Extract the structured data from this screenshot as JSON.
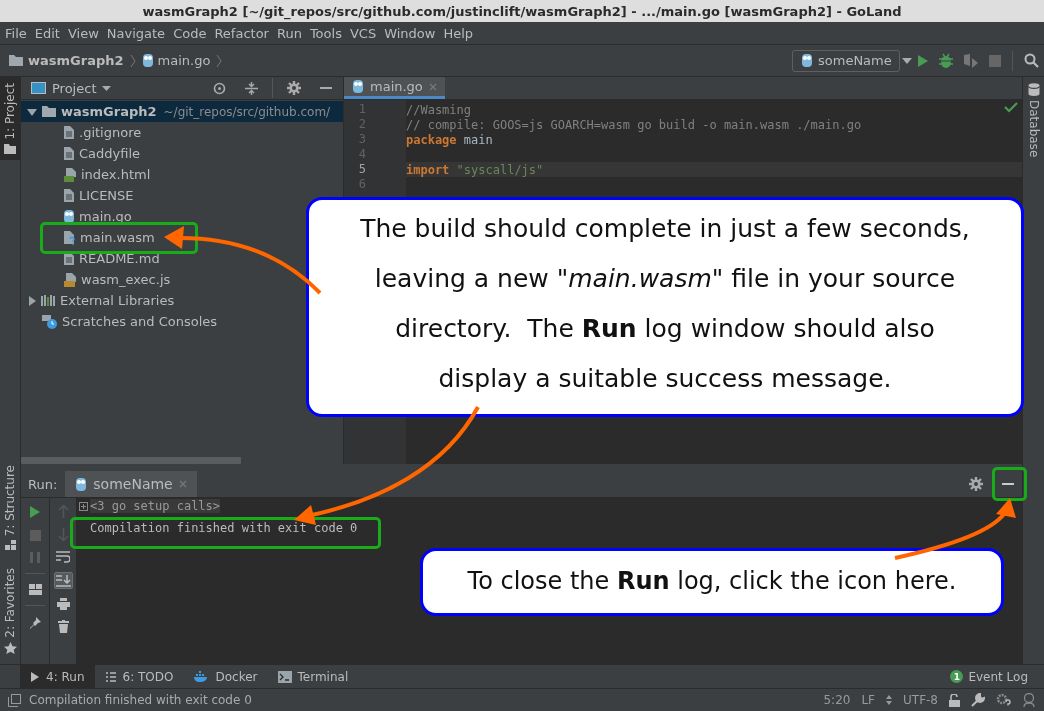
{
  "window": {
    "title": "wasmGraph2 [~/git_repos/src/github.com/justinclift/wasmGraph2] - .../main.go [wasmGraph2] - GoLand"
  },
  "menu": [
    "File",
    "Edit",
    "View",
    "Navigate",
    "Code",
    "Refactor",
    "Run",
    "Tools",
    "VCS",
    "Window",
    "Help"
  ],
  "breadcrumb": [
    {
      "label": "wasmGraph2",
      "kind": "folder"
    },
    {
      "label": "main.go",
      "kind": "go"
    }
  ],
  "run_config": {
    "label": "someName"
  },
  "left_stripe_top": [
    {
      "label": "1: Project",
      "selected": true
    }
  ],
  "left_stripe_bottom": [
    {
      "label": "7: Structure",
      "selected": false
    },
    {
      "label": "2: Favorites",
      "selected": false
    }
  ],
  "right_stripe": [
    {
      "label": "Database",
      "selected": false
    }
  ],
  "project_panel": {
    "title": "Project",
    "tree": [
      {
        "label": "wasmGraph2",
        "path": "~/git_repos/src/github.com/",
        "kind": "folder",
        "expanded": true,
        "selected": true,
        "children": [
          {
            "label": ".gitignore",
            "kind": "text",
            "selected": false
          },
          {
            "label": "Caddyfile",
            "kind": "text",
            "selected": false
          },
          {
            "label": "index.html",
            "kind": "html",
            "selected": false
          },
          {
            "label": "LICENSE",
            "kind": "text",
            "selected": false
          },
          {
            "label": "main.go",
            "kind": "go",
            "selected": false
          },
          {
            "label": "main.wasm",
            "kind": "unknown",
            "selected": false
          },
          {
            "label": "README.md",
            "kind": "text",
            "selected": false
          },
          {
            "label": "wasm_exec.js",
            "kind": "js",
            "selected": false
          }
        ]
      },
      {
        "label": "External Libraries",
        "kind": "libraries",
        "expanded": false,
        "selected": false
      },
      {
        "label": "Scratches and Consoles",
        "kind": "scratches",
        "selected": false
      }
    ]
  },
  "editor": {
    "tabs": [
      {
        "label": "main.go",
        "selected": true
      }
    ],
    "lines": [
      {
        "number": "1",
        "current": false,
        "tokens": [
          {
            "kind": "comment",
            "text": "//Wasming"
          }
        ]
      },
      {
        "number": "2",
        "current": false,
        "tokens": [
          {
            "kind": "comment",
            "text": "// compile: GOOS=js GOARCH=wasm go build -o main.wasm ./main.go"
          }
        ]
      },
      {
        "number": "3",
        "current": false,
        "tokens": [
          {
            "kind": "keyword",
            "text": "package"
          },
          {
            "kind": "plain",
            "text": " main"
          }
        ]
      },
      {
        "number": "4",
        "current": false
      },
      {
        "number": "5",
        "current": true,
        "tokens": [
          {
            "kind": "keyword",
            "text": "import"
          },
          {
            "kind": "string",
            "text": " \"syscall/js\""
          }
        ]
      },
      {
        "number": "6",
        "current": false
      }
    ]
  },
  "run_panel": {
    "title": "Run:",
    "tabs": [
      {
        "label": "someName",
        "selected": true
      }
    ],
    "scroll_to_end_on": true,
    "console": [
      {
        "kind": "folded",
        "text": "<3 go setup calls>"
      },
      {
        "kind": "output",
        "text": "Compilation finished with exit code 0"
      }
    ]
  },
  "tool_tabs": [
    {
      "label": "4: Run",
      "kind": "run",
      "selected": true
    },
    {
      "label": "6: TODO",
      "kind": "todo",
      "selected": false
    },
    {
      "label": "Docker",
      "kind": "docker",
      "selected": false
    },
    {
      "label": "Terminal",
      "kind": "terminal",
      "selected": false
    }
  ],
  "event_log": {
    "label": "Event Log",
    "count": "1"
  },
  "status_bar": {
    "message": "Compilation finished with exit code 0",
    "position": "5:20",
    "line_separator": "LF",
    "encoding": "UTF-8"
  },
  "callouts": [
    {
      "text": "The build should complete in just a few seconds, leaving a new \"*main.wasm*\" file in your source directory.  The **Run** log window should also display a suitable success message."
    },
    {
      "text": "To close the **Run** log, click the icon here."
    }
  ]
}
